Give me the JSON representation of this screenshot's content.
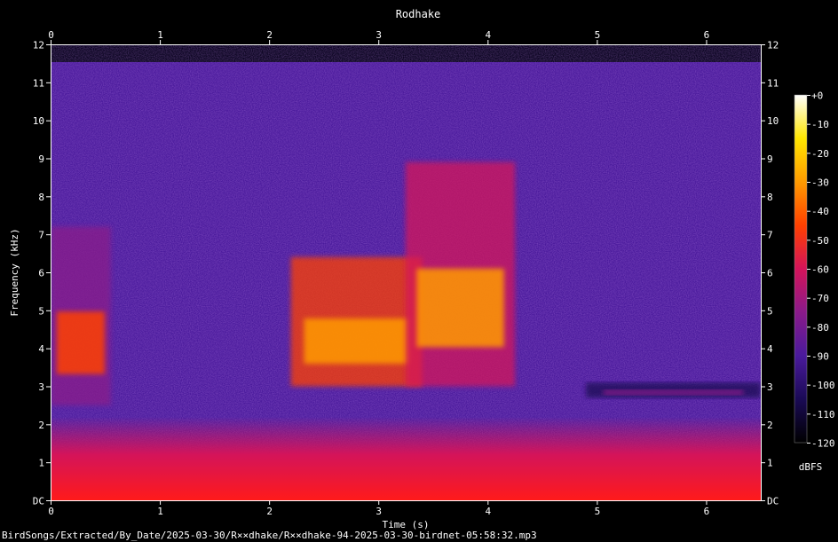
{
  "chart_data": {
    "type": "heatmap",
    "subtype": "spectrogram",
    "title": "Rodhake",
    "xlabel": "Time (s)",
    "ylabel": "Frequency (kHz)",
    "xlim": [
      0,
      6.5
    ],
    "ylim": [
      0,
      12
    ],
    "x_ticks": [
      "0",
      "1",
      "2",
      "3",
      "4",
      "5",
      "6"
    ],
    "y_ticks": [
      "DC",
      "1",
      "2",
      "3",
      "4",
      "5",
      "6",
      "7",
      "8",
      "9",
      "10",
      "11",
      "12"
    ],
    "colorbar": {
      "label": "dBFS",
      "range": [
        -120,
        0
      ],
      "ticks": [
        "+0",
        "-10",
        "-20",
        "-30",
        "-40",
        "-50",
        "-60",
        "-70",
        "-80",
        "-90",
        "-100",
        "-110",
        "-120"
      ],
      "colormap": [
        "#000000",
        "#1a0a55",
        "#4a1a9c",
        "#8a1a8a",
        "#d4145a",
        "#ff4000",
        "#ff9a00",
        "#ffe600",
        "#ffffff"
      ]
    },
    "background_level_dbfs": -90,
    "low_frequency_band": {
      "freq_khz": [
        0,
        2
      ],
      "level_dbfs": -60
    },
    "events": [
      {
        "t_start": 0.0,
        "t_end": 0.55,
        "f_low_khz": 2.5,
        "f_high_khz": 7.2,
        "peak_dbfs": -50
      },
      {
        "t_start": 2.2,
        "t_end": 3.4,
        "f_low_khz": 3.0,
        "f_high_khz": 6.4,
        "peak_dbfs": -25
      },
      {
        "t_start": 3.25,
        "t_end": 4.25,
        "f_low_khz": 3.0,
        "f_high_khz": 8.9,
        "peak_dbfs": -30
      },
      {
        "t_start": 4.9,
        "t_end": 6.5,
        "f_low_khz": 2.7,
        "f_high_khz": 3.1,
        "peak_dbfs": -75
      }
    ],
    "file_path": "BirdSongs/Extracted/By_Date/2025-03-30/R××dhake/R××dhake-94-2025-03-30-birdnet-05:58:32.mp3"
  }
}
